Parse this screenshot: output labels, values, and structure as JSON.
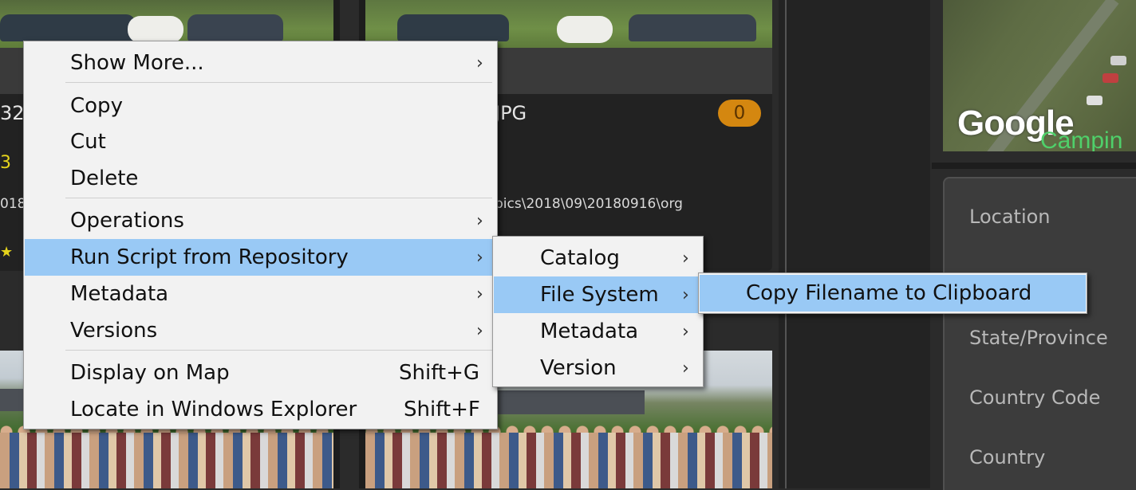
{
  "background": {
    "thumb_fragments": {
      "left_number": "32",
      "left_yellow": "3",
      "left_path": "018",
      "right_ext": "JPG",
      "right_path": "pics\\2018\\09\\20180916\\org"
    },
    "badge_count": "0",
    "map": {
      "logo": "Google",
      "place_fragment": "Campin"
    },
    "location_fields": [
      "Location",
      "State/Province",
      "Country Code",
      "Country"
    ]
  },
  "menu": {
    "items": [
      {
        "label": "Show More...",
        "arrow": "›"
      },
      {
        "label": "Copy"
      },
      {
        "label": "Cut"
      },
      {
        "label": "Delete"
      },
      {
        "label": "Operations",
        "arrow": "›"
      },
      {
        "label": "Run Script from Repository",
        "arrow": "›"
      },
      {
        "label": "Metadata",
        "arrow": "›"
      },
      {
        "label": "Versions",
        "arrow": "›"
      },
      {
        "label": "Display on Map",
        "shortcut": "Shift+G"
      },
      {
        "label": "Locate in Windows Explorer",
        "shortcut": "Shift+F"
      }
    ]
  },
  "submenu": {
    "items": [
      {
        "label": "Catalog",
        "arrow": "›"
      },
      {
        "label": "File System",
        "arrow": "›"
      },
      {
        "label": "Metadata",
        "arrow": "›"
      },
      {
        "label": "Version",
        "arrow": "›"
      }
    ]
  },
  "subsubmenu": {
    "items": [
      {
        "label": "Copy Filename to Clipboard"
      }
    ]
  },
  "colors": {
    "highlight": "#99c9f5",
    "menu_bg": "#f2f2f2",
    "badge": "#d48710",
    "app_bg": "#2b2b2b"
  }
}
